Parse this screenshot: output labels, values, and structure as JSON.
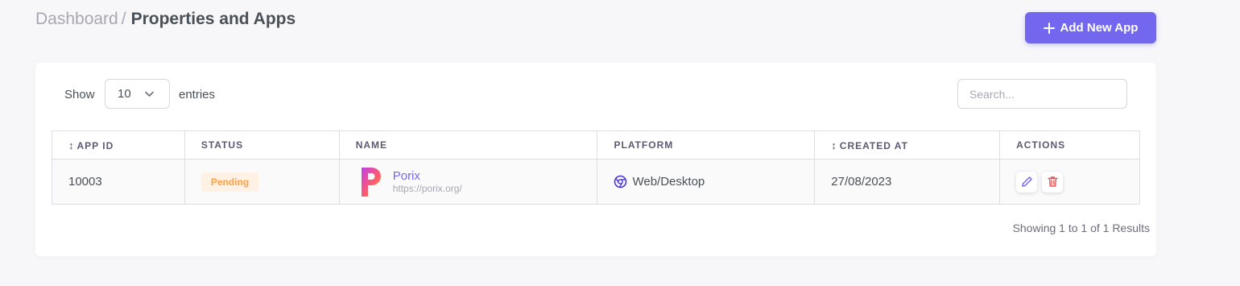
{
  "breadcrumb": {
    "root": "Dashboard",
    "separator": "/",
    "current": "Properties and Apps"
  },
  "add_button": {
    "label": "Add New App",
    "icon": "plus-icon"
  },
  "length_control": {
    "show_label": "Show",
    "selected": "10",
    "entries_label": "entries"
  },
  "search": {
    "placeholder": "Search..."
  },
  "table": {
    "columns": [
      {
        "label": "APP ID",
        "sortable": true
      },
      {
        "label": "STATUS",
        "sortable": false
      },
      {
        "label": "NAME",
        "sortable": false
      },
      {
        "label": "PLATFORM",
        "sortable": false
      },
      {
        "label": "CREATED AT",
        "sortable": true
      },
      {
        "label": "ACTIONS",
        "sortable": false
      }
    ],
    "sort_glyph": "↕",
    "rows": [
      {
        "app_id": "10003",
        "status": "Pending",
        "name": "Porix",
        "url": "https://porix.org/",
        "platform": "Web/Desktop",
        "created_at": "27/08/2023"
      }
    ]
  },
  "footer": {
    "results_text": "Showing 1 to 1 of 1 Results"
  },
  "colors": {
    "primary": "#7367f0",
    "warning": "#ff9f43",
    "danger": "#ea5455",
    "background": "#f7f7fa"
  }
}
